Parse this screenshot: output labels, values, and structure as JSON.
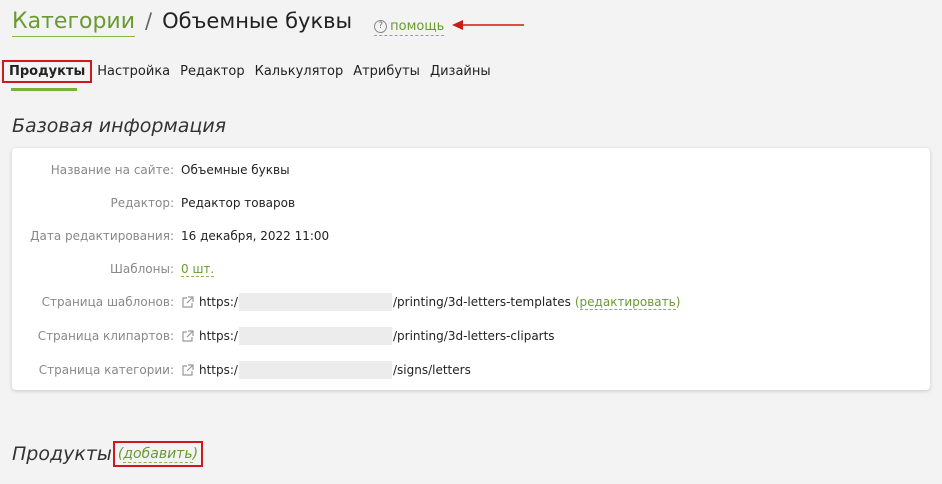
{
  "header": {
    "breadcrumb_link": "Категории",
    "separator": "/",
    "title": "Объемные буквы",
    "help_label": "помощь"
  },
  "tabs": [
    {
      "label": "Продукты"
    },
    {
      "label": "Настройка"
    },
    {
      "label": "Редактор"
    },
    {
      "label": "Калькулятор"
    },
    {
      "label": "Атрибуты"
    },
    {
      "label": "Дизайны"
    }
  ],
  "basic_info": {
    "title": "Базовая информация",
    "rows": {
      "site_name": {
        "label": "Название на сайте:",
        "value": "Объемные буквы"
      },
      "editor": {
        "label": "Редактор:",
        "value": "Редактор товаров"
      },
      "edit_date": {
        "label": "Дата редактирования:",
        "value": "16 декабря, 2022 11:00"
      },
      "templates": {
        "label": "Шаблоны:",
        "value": "0 шт."
      },
      "templates_page": {
        "label": "Страница шаблонов:",
        "url_prefix": "https:/",
        "url_suffix": "/printing/3d-letters-templates",
        "edit_label": "редактировать"
      },
      "cliparts_page": {
        "label": "Страница клипартов:",
        "url_prefix": "https:/",
        "url_suffix": "/printing/3d-letters-cliparts"
      },
      "category_page": {
        "label": "Страница категории:",
        "url_prefix": "https:/",
        "url_suffix": "/signs/letters"
      }
    }
  },
  "products": {
    "title": "Продукты",
    "add_label": "добавить"
  },
  "colors": {
    "accent_green": "#6b9a31",
    "highlight_red": "#cc1a1a"
  }
}
